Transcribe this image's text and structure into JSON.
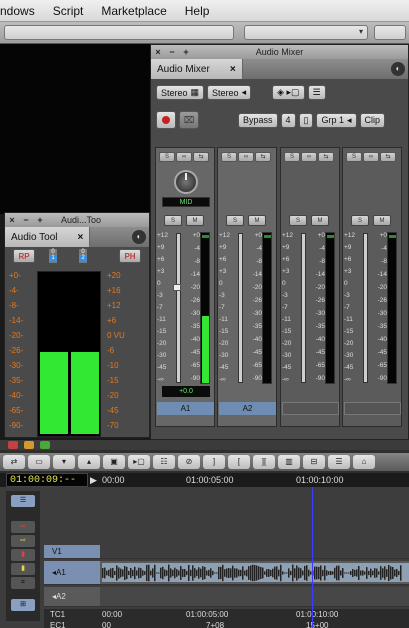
{
  "menubar": {
    "items": [
      "ndows",
      "Script",
      "Marketplace",
      "Help"
    ]
  },
  "mixer": {
    "window_title": "Audio Mixer",
    "tab_label": "Audio Mixer",
    "tab_close": "×",
    "win_buttons": [
      "×",
      "−",
      "+"
    ],
    "toolbar1": {
      "stereo1": "Stereo",
      "stereo2": "Stereo"
    },
    "toolbar2": {
      "bypass": "Bypass",
      "num": "4",
      "grp": "Grp 1",
      "clip": "Clip"
    },
    "strips": [
      {
        "name": "A1",
        "pan": "MID",
        "level": "+0.0",
        "meter_fill": 0.45,
        "selected": true
      },
      {
        "name": "A2",
        "pan": "",
        "level": "",
        "meter_fill": 0.0,
        "selected": true
      },
      {
        "name": "",
        "pan": "",
        "level": "",
        "meter_fill": 0.0,
        "selected": false
      },
      {
        "name": "",
        "pan": "",
        "level": "",
        "meter_fill": 0.0,
        "selected": false
      }
    ],
    "fader_scale": [
      "+12",
      "+9",
      "+6",
      "+3",
      "0",
      "-3",
      "-7",
      "-11",
      "-15",
      "-20",
      "-30",
      "-45",
      "-∞"
    ],
    "meter_scale": [
      "+0",
      "-4",
      "-8",
      "-14",
      "-20",
      "-26",
      "-30",
      "-35",
      "-40",
      "-45",
      "-65",
      "-90"
    ]
  },
  "audio_tool": {
    "window_title": "Audi...Too",
    "tab_label": "Audio Tool",
    "tab_close": "×",
    "win_buttons": [
      "×",
      "−",
      "+"
    ],
    "rp": "RP",
    "ph": "PH",
    "ch1": "1",
    "ch2": "2",
    "left_scale": [
      "+0-",
      "-4-",
      "-8-",
      "-14-",
      "-20-",
      "-26-",
      "-30-",
      "-35-",
      "-40-",
      "-65-",
      "-90-"
    ],
    "right_scale": [
      "+20",
      "+16",
      "+12",
      "+6",
      "0 VU",
      "-6",
      "-10",
      "-15",
      "-20",
      "-45",
      "-70"
    ],
    "fill_level": 0.5
  },
  "timeline": {
    "timecode": "01:00:09:--",
    "ruler_marks": [
      "00:00",
      "01:00:05:00",
      "01:00:10:00"
    ],
    "tracks": [
      {
        "label": "V1"
      },
      {
        "label": "◂A1"
      },
      {
        "label": "◂A2"
      }
    ],
    "tc1_label": "TC1",
    "tc1_marks": [
      "00:00",
      "01:00:05:00",
      "01:00:10:00"
    ],
    "ec1_label": "EC1",
    "ec1_marks": [
      "00",
      "7+08",
      "15+00"
    ]
  },
  "colors": {
    "meter_green": "#33e833",
    "timecode_yellow": "#e7e94a",
    "track_blue": "#7a8fb2"
  }
}
